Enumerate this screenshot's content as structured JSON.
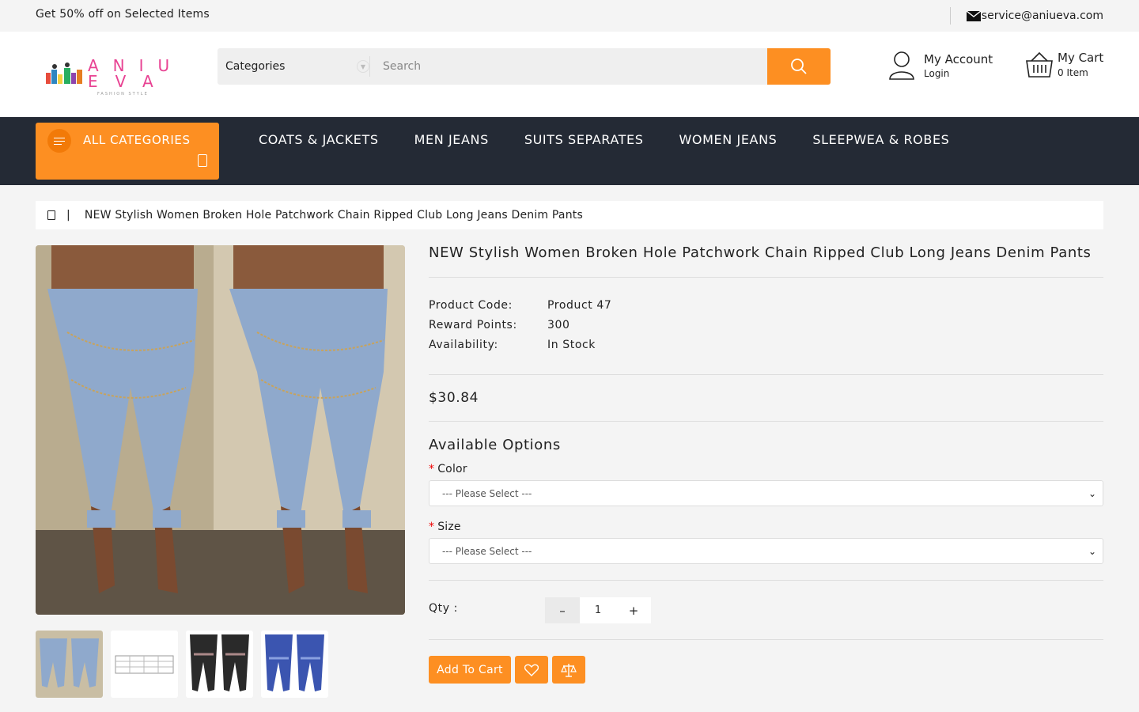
{
  "topbar": {
    "promo": "Get 50% off on Selected Items",
    "email": "service@aniueva.com"
  },
  "header": {
    "logo_letters_top": "A N I U",
    "logo_letters_bottom": "E V A",
    "logo_tagline": "FASHION STYLE",
    "search_category": "Categories",
    "search_placeholder": "Search",
    "account_title": "My Account",
    "account_sub": "Login",
    "cart_title": "My Cart",
    "cart_sub": "0 Item"
  },
  "nav": {
    "all_categories": "ALL CATEGORIES",
    "links": [
      "COATS & JACKETS",
      "MEN JEANS",
      "SUITS SEPARATES",
      "WOMEN JEANS",
      "SLEEPWEA & ROBES"
    ]
  },
  "breadcrumb": {
    "separator": "|",
    "current": "NEW Stylish Women Broken Hole Patchwork Chain Ripped Club Long Jeans Denim Pants"
  },
  "product": {
    "title": "NEW Stylish Women Broken Hole Patchwork Chain Ripped Club Long Jeans Denim Pants",
    "specs": [
      {
        "label": "Product Code:",
        "value": "Product 47"
      },
      {
        "label": "Reward Points:",
        "value": "300"
      },
      {
        "label": "Availability:",
        "value": "In Stock"
      }
    ],
    "price": "$30.84",
    "options_title": "Available Options",
    "color_label": "Color",
    "color_value": "--- Please Select ---",
    "size_label": "Size",
    "size_value": "--- Please Select ---",
    "required_mark": "*",
    "qty_label": "Qty :",
    "qty_value": "1",
    "qty_minus": "–",
    "qty_plus": "+",
    "add_to_cart": "Add To Cart"
  },
  "colors": {
    "accent": "#fd8f22",
    "nav_bg": "#242a35"
  }
}
